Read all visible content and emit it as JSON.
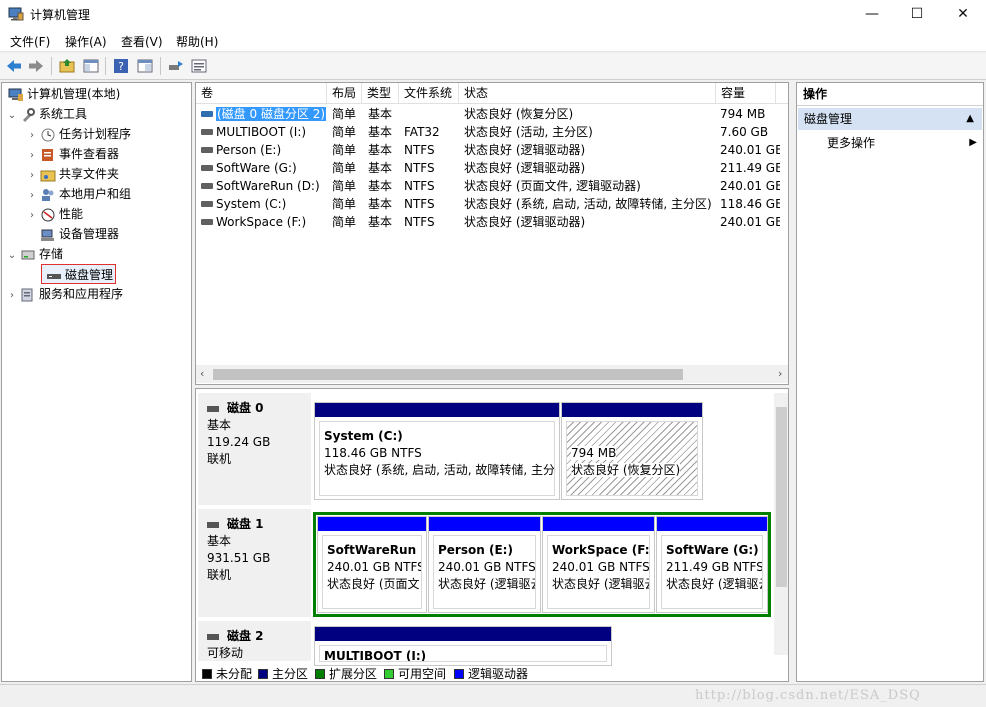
{
  "window": {
    "title": "计算机管理",
    "minimize": "—",
    "maximize": "☐",
    "close": "✕"
  },
  "menu": [
    "文件(F)",
    "操作(A)",
    "查看(V)",
    "帮助(H)"
  ],
  "tree": {
    "root": "计算机管理(本地)",
    "system_tools": "系统工具",
    "items": [
      "任务计划程序",
      "事件查看器",
      "共享文件夹",
      "本地用户和组",
      "性能",
      "设备管理器"
    ],
    "storage": "存储",
    "disk_management": "磁盘管理",
    "services": "服务和应用程序"
  },
  "volumes": {
    "headers": [
      "卷",
      "布局",
      "类型",
      "文件系统",
      "状态",
      "容量"
    ],
    "rows": [
      {
        "name": "(磁盘 0 磁盘分区 2)",
        "layout": "简单",
        "type": "基本",
        "fs": "",
        "status": "状态良好 (恢复分区)",
        "capacity": "794 MB"
      },
      {
        "name": "MULTIBOOT (I:)",
        "layout": "简单",
        "type": "基本",
        "fs": "FAT32",
        "status": "状态良好 (活动, 主分区)",
        "capacity": "7.60 GB"
      },
      {
        "name": "Person (E:)",
        "layout": "简单",
        "type": "基本",
        "fs": "NTFS",
        "status": "状态良好 (逻辑驱动器)",
        "capacity": "240.01 GB"
      },
      {
        "name": "SoftWare (G:)",
        "layout": "简单",
        "type": "基本",
        "fs": "NTFS",
        "status": "状态良好 (逻辑驱动器)",
        "capacity": "211.49 GB"
      },
      {
        "name": "SoftWareRun (D:)",
        "layout": "简单",
        "type": "基本",
        "fs": "NTFS",
        "status": "状态良好 (页面文件, 逻辑驱动器)",
        "capacity": "240.01 GB"
      },
      {
        "name": "System (C:)",
        "layout": "简单",
        "type": "基本",
        "fs": "NTFS",
        "status": "状态良好 (系统, 启动, 活动, 故障转储, 主分区)",
        "capacity": "118.46 GB"
      },
      {
        "name": "WorkSpace (F:)",
        "layout": "简单",
        "type": "基本",
        "fs": "NTFS",
        "status": "状态良好 (逻辑驱动器)",
        "capacity": "240.01 GB"
      }
    ]
  },
  "disks": [
    {
      "name": "磁盘 0",
      "type": "基本",
      "size": "119.24 GB",
      "state": "联机",
      "partitions": [
        {
          "name": "System  (C:)",
          "size": "118.46 GB NTFS",
          "status": "状态良好 (系统, 启动, 活动, 故障转储, 主分["
        },
        {
          "name": "",
          "size": "794 MB",
          "status": "状态良好 (恢复分区)"
        }
      ]
    },
    {
      "name": "磁盘 1",
      "type": "基本",
      "size": "931.51 GB",
      "state": "联机",
      "partitions": [
        {
          "name": "SoftWareRun  (",
          "size": "240.01 GB NTFS",
          "status": "状态良好 (页面文"
        },
        {
          "name": "Person  (E:)",
          "size": "240.01 GB NTFS",
          "status": "状态良好 (逻辑驱云"
        },
        {
          "name": "WorkSpace  (F:)",
          "size": "240.01 GB NTFS",
          "status": "状态良好 (逻辑驱云"
        },
        {
          "name": "SoftWare  (G:)",
          "size": "211.49 GB NTFS",
          "status": "状态良好 (逻辑驱云"
        }
      ]
    },
    {
      "name": "磁盘 2",
      "type": "可移动",
      "size": "",
      "state": "",
      "partitions": [
        {
          "name": "MULTIBOOT  (I:)",
          "size": "",
          "status": ""
        }
      ]
    }
  ],
  "legend": [
    {
      "label": "未分配",
      "color": "#000000"
    },
    {
      "label": "主分区",
      "color": "#000080"
    },
    {
      "label": "扩展分区",
      "color": "#008000"
    },
    {
      "label": "可用空间",
      "color": "#33cc33"
    },
    {
      "label": "逻辑驱动器",
      "color": "#0000ff"
    }
  ],
  "actions": {
    "title": "操作",
    "section": "磁盘管理",
    "more": "更多操作"
  },
  "watermark": "http://blog.csdn.net/ESA_DSQ"
}
